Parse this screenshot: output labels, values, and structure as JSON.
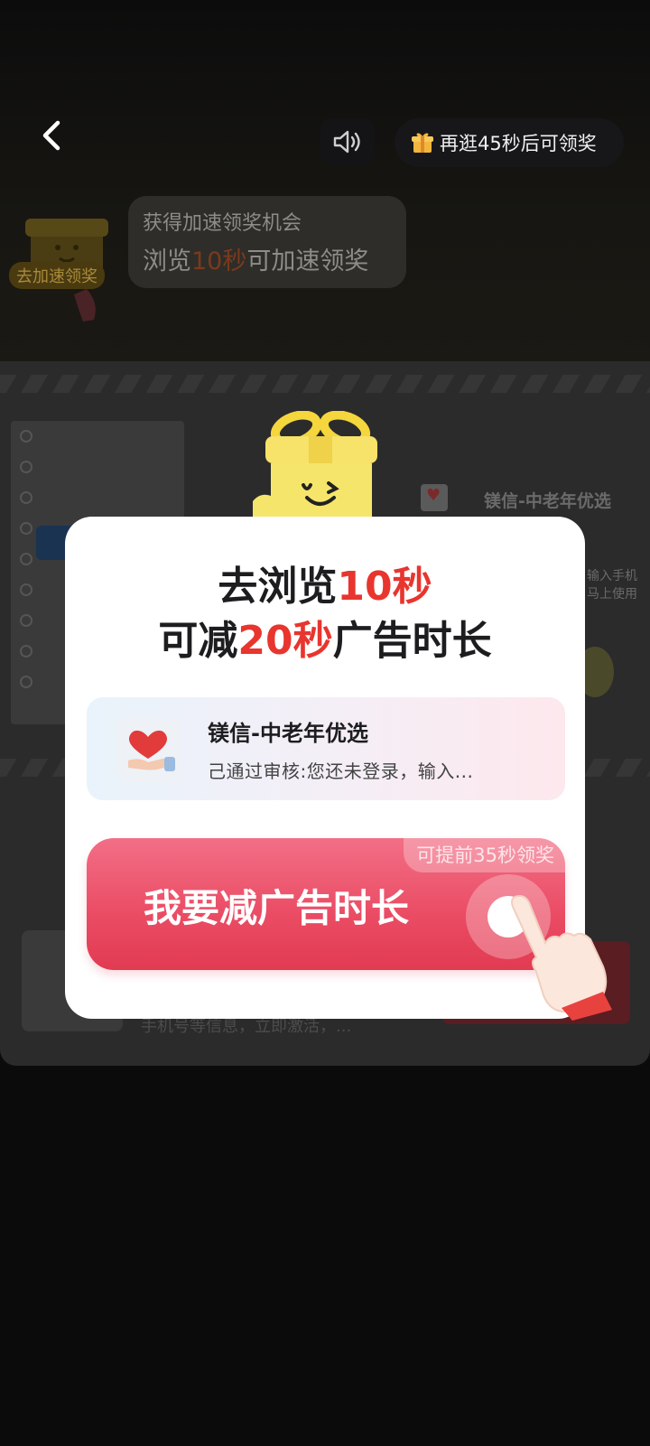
{
  "topbar": {
    "reward_text": "再逛45秒后可领奖"
  },
  "speed_up": {
    "tag": "去加速领奖",
    "line1": "获得加速领奖机会",
    "line2_prefix": "浏览",
    "line2_highlight": "10秒",
    "line2_suffix": "可加速领奖"
  },
  "background_ad": {
    "brand": "镁信-中老年优选",
    "hint_line1": "输入手机",
    "hint_line2": "马上使用",
    "lower_text": "手机号等信息，立即激活，..."
  },
  "modal": {
    "title_line1_prefix": "去浏览",
    "title_line1_highlight": "10秒",
    "title_line2_prefix": "可减",
    "title_line2_highlight": "20秒",
    "title_line2_suffix": "广告时长",
    "app": {
      "name": "镁信-中老年优选",
      "description": "己通过审核:您还未登录，输入..."
    },
    "cta_label": "我要减广告时长",
    "cta_badge": "可提前35秒领奖"
  },
  "colors": {
    "highlight_red": "#e8352e",
    "cta_pink": "#ea4b63",
    "overlay_bg": "#0b0b0c"
  },
  "icons": [
    "back-arrow-icon",
    "speaker-icon",
    "gift-icon",
    "mascot-gift-box-icon",
    "heart-in-hand-icon",
    "tap-hand-icon"
  ]
}
